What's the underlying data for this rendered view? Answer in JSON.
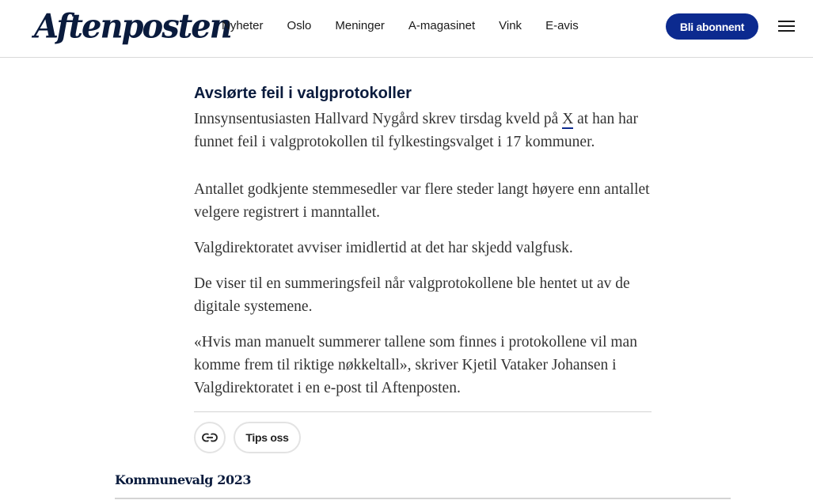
{
  "header": {
    "logo": "Aftenposten",
    "nav": [
      "Nyheter",
      "Oslo",
      "Meninger",
      "A-magasinet",
      "Vink",
      "E-avis"
    ],
    "subscribe_label": "Bli abonnent"
  },
  "article": {
    "headline": "Avslørte feil i valgprotokoller",
    "lead_before": "Innsynsentusiasten Hallvard Nygård skrev tirsdag kveld på ",
    "lead_link": "X",
    "lead_after": " at han har funnet feil i valgprotokollen til fylkestingsvalget i 17 kommuner.",
    "paragraphs": [
      "Antallet godkjente stemmesedler var flere steder langt høyere enn antallet velgere registrert i manntallet.",
      "Valgdirektoratet avviser imidlertid at det har skjedd valgfusk.",
      "De viser til en summeringsfeil når valgprotokollene ble hentet ut av de digitale systemene.",
      "«Hvis man manuelt summerer tallene som finnes i protokollene vil man komme frem til riktige nøkkeltall», skriver Kjetil Vataker Johansen i Valgdirektoratet i en e-post til Aftenposten."
    ]
  },
  "actions": {
    "link_icon": "link-icon",
    "tips_label": "Tips oss"
  },
  "section": {
    "title": "Kommunevalg 2023"
  },
  "colors": {
    "brand_navy": "#0a1b3d",
    "button_blue": "#0c2a8f"
  }
}
